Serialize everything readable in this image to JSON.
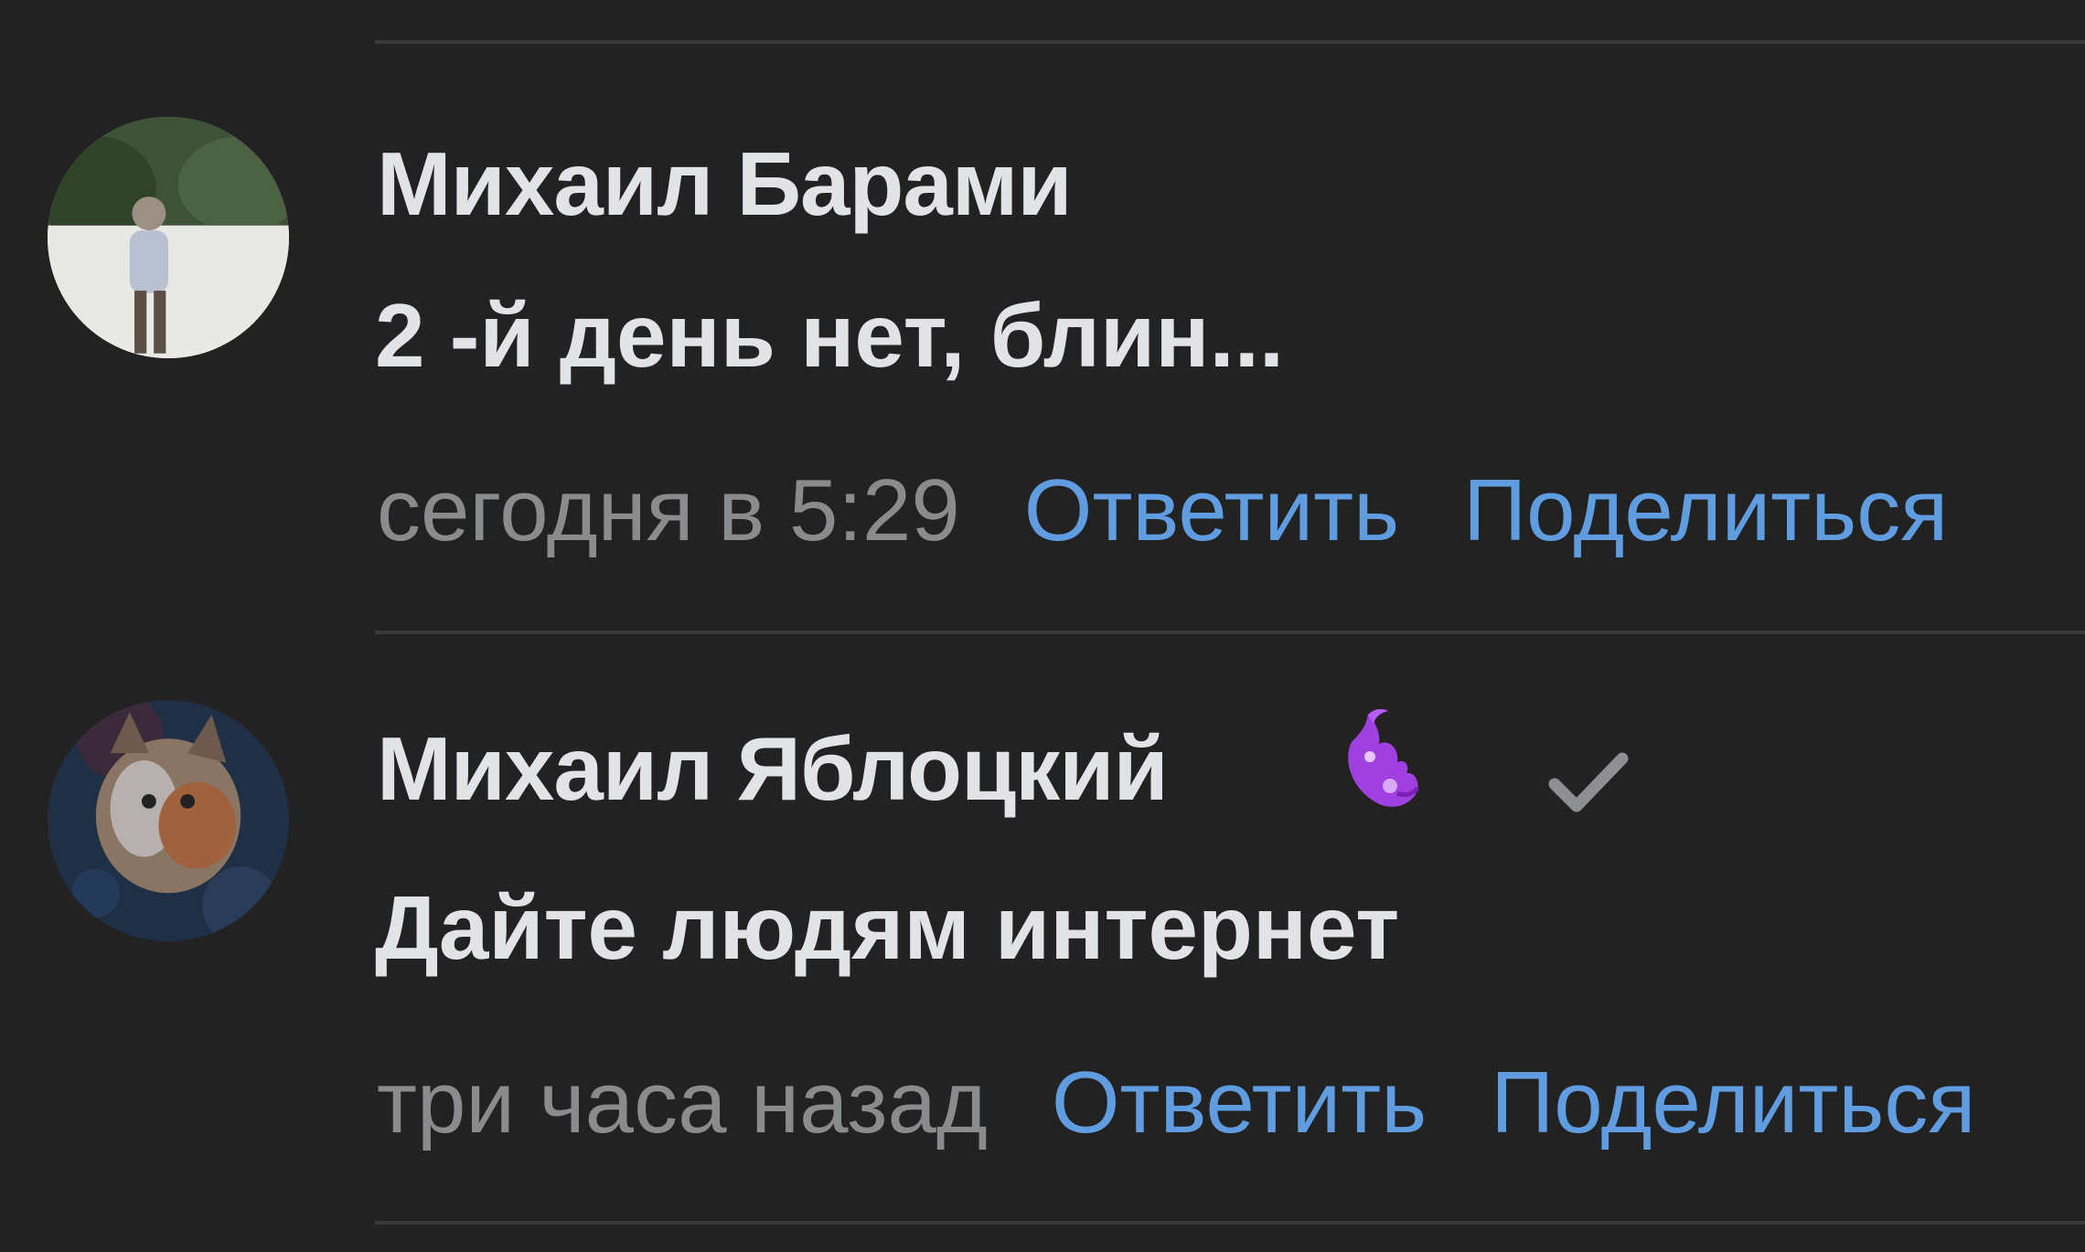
{
  "comments": [
    {
      "author": "Михаил Барами",
      "text": "2 -й день нет, блин...",
      "time": "сегодня в 5:29",
      "reply_label": "Ответить",
      "share_label": "Поделиться"
    },
    {
      "author": "Михаил Яблоцкий",
      "text": "Дайте людям интернет",
      "time": "три часа назад",
      "reply_label": "Ответить",
      "share_label": "Поделиться",
      "badge_icon": "purple-dragon-badge-icon",
      "check_icon": "checkmark-icon"
    }
  ],
  "colors": {
    "background": "#222223",
    "text": "#e1e3e6",
    "muted": "#8a8b8d",
    "link": "#5f9de0",
    "divider": "#3a3a3b",
    "badge": "#a040e0"
  }
}
